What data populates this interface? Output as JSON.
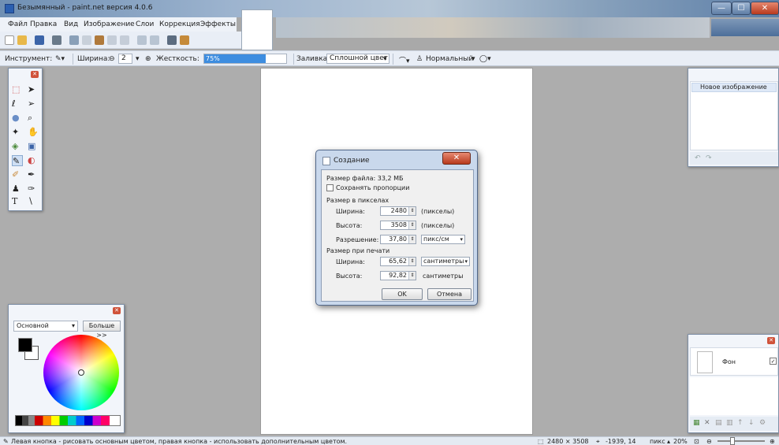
{
  "window": {
    "title": "Безымянный - paint.net версия 4.0.6",
    "minimize": "—",
    "maximize": "☐",
    "close": "✕"
  },
  "menu": [
    "Файл",
    "Правка",
    "Вид",
    "Изображение",
    "Слои",
    "Коррекция",
    "Эффекты"
  ],
  "toolbar": {
    "tool_label": "Инструмент:",
    "width_label": "Ширина:",
    "width_value": "2",
    "hardness_label": "Жесткость:",
    "hardness_value": "75%",
    "hardness_fraction": 0.75,
    "fill_label": "Заливка:",
    "fill_value": "Сплошной цвет",
    "blend_value": "Нормальный"
  },
  "history": {
    "item": "Новое изображение"
  },
  "colors": {
    "mode": "Основной",
    "more_button": "Больше >>"
  },
  "layers": {
    "layer_name": "Фон",
    "visible": "✓"
  },
  "dialog": {
    "title": "Создание",
    "file_size": "Размер файла: 33,2 МБ",
    "keep_ratio": "Сохранять пропорции",
    "pixel_section": "Размер в пикселах",
    "print_section": "Размер при печати",
    "px_width_label": "Ширина:",
    "px_width_value": "2480",
    "px_width_unit": "(пикселы)",
    "px_height_label": "Высота:",
    "px_height_value": "3508",
    "px_height_unit": "(пикселы)",
    "resolution_label": "Разрешение:",
    "resolution_value": "37,80",
    "resolution_unit": "пикс/см",
    "print_width_label": "Ширина:",
    "print_width_value": "65,62",
    "print_width_unit": "сантиметры",
    "print_height_label": "Высота:",
    "print_height_value": "92,82",
    "print_height_unit": "сантиметры",
    "ok": "OK",
    "cancel": "Отмена"
  },
  "status": {
    "hint": "Левая кнопка - рисовать основным цветом, правая кнопка - использовать дополнительным цветом.",
    "size": "2480 × 3508",
    "cursor": "-1939, 14",
    "units": "пикс",
    "zoom": "20%"
  },
  "accent": "#3d8de0"
}
